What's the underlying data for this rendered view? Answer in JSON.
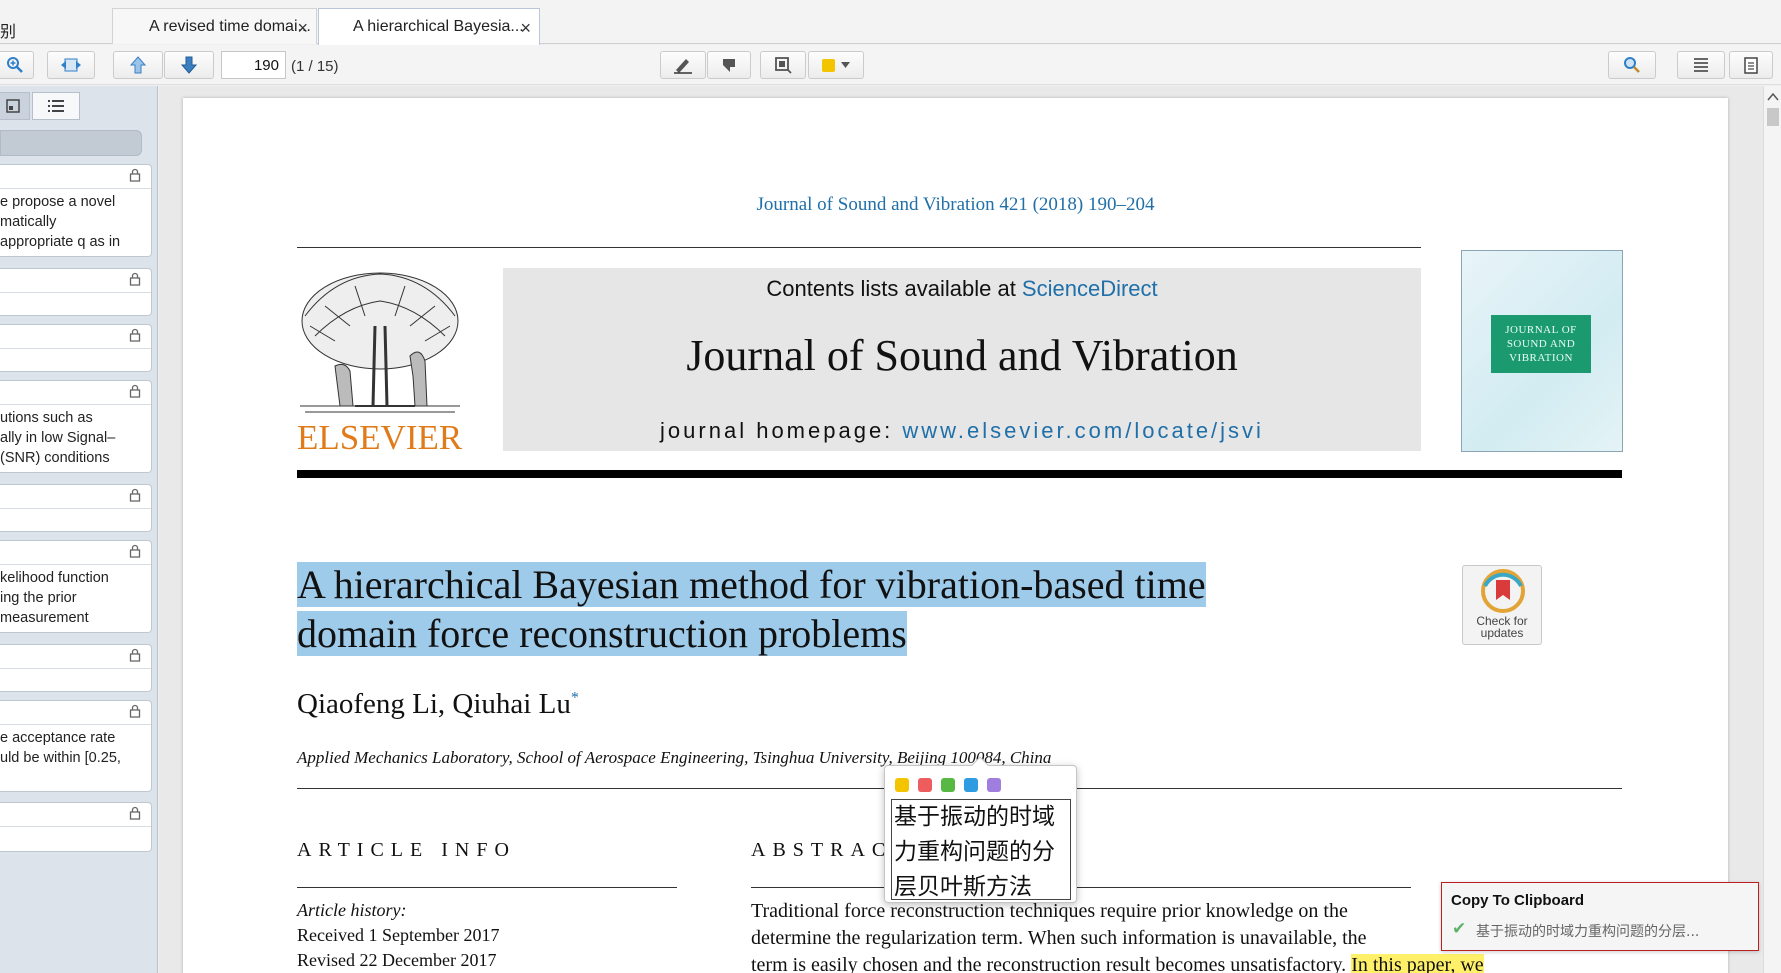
{
  "tabs": {
    "left_fragment": "别",
    "items": [
      {
        "label": "A revised time domai...",
        "close": "×",
        "active": false
      },
      {
        "label": "A hierarchical Bayesia...",
        "close": "×",
        "active": true
      }
    ]
  },
  "toolbar": {
    "page_value": "190",
    "page_total": "(1 / 15)",
    "highlight_color": "#f2c500"
  },
  "sidebar": {
    "notes": [
      {
        "lines": [
          "e propose a novel",
          "matically",
          "appropriate q as in"
        ]
      },
      {
        "lines": [
          ""
        ]
      },
      {
        "lines": [
          ""
        ]
      },
      {
        "lines": [
          "utions such as",
          "ally in low Signal–",
          "(SNR) conditions"
        ]
      },
      {
        "lines": [
          ""
        ]
      },
      {
        "lines": [
          "kelihood function",
          "ing the prior",
          " measurement"
        ]
      },
      {
        "lines": [
          ""
        ]
      },
      {
        "lines": [
          "e acceptance rate",
          "uld be within [0.25,"
        ]
      },
      {
        "lines": [
          ""
        ]
      }
    ]
  },
  "paper": {
    "journal_ref": "Journal of Sound and Vibration 421 (2018) 190–204",
    "contents_prefix": "Contents lists available at ",
    "contents_link": "ScienceDirect",
    "journal_name": "Journal of Sound and Vibration",
    "homepage_prefix": "journal homepage: ",
    "homepage_url": "www.elsevier.com/locate/jsvi",
    "publisher": "ELSEVIER",
    "cover_title": "JOURNAL OF SOUND AND VIBRATION",
    "check_badge": "Check for updates",
    "title_line1": "A hierarchical Bayesian method for vibration-based time",
    "title_line2": "domain force reconstruction problems",
    "authors": "Qiaofeng Li, Qiuhai Lu",
    "author_mark": "*",
    "affiliation": "Applied Mechanics Laboratory, School of Aerospace Engineering, Tsinghua University, Beijing 100084, China",
    "article_info_heading": "ARTICLE INFO",
    "abstract_heading": "ABSTRACT",
    "history_label": "Article history:",
    "received": "Received 1 September 2017",
    "revised": "Revised 22 December 2017",
    "abstract_line1": "Traditional force reconstruction techniques require prior knowledge on the",
    "abstract_line2": "determine the regularization term. When such information is unavailable, the",
    "abstract_line3": "term is easily chosen and the reconstruction result becomes unsatisfactory. ",
    "abstract_highlight": "In this paper, we"
  },
  "popup": {
    "colors": [
      "#f5c400",
      "#ee5d5d",
      "#57b843",
      "#2f9be0",
      "#a07ee0"
    ],
    "translation": "基于振动的时域力重构问题的分层贝叶斯方法"
  },
  "toast": {
    "title": "Copy To Clipboard",
    "message": "基于振动的时域力重构问题的分层..."
  }
}
